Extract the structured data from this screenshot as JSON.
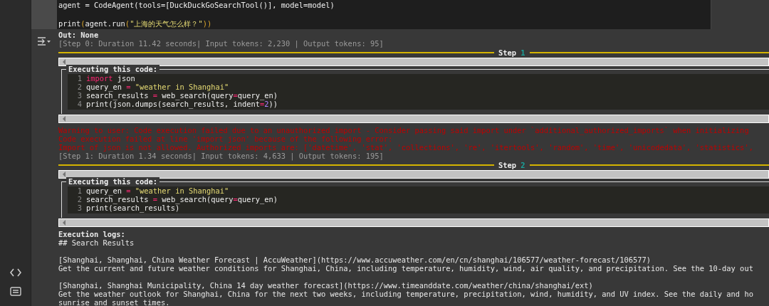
{
  "code_cell": {
    "lines": [
      {
        "kind": "code",
        "tokens": [
          {
            "text": "agent = CodeAgent(tools=[DuckDuckGoSearchTool()], model=model)",
            "kind": "plain"
          }
        ]
      },
      {
        "kind": "blank"
      },
      {
        "kind": "code",
        "tokens": [
          {
            "text": "print",
            "kind": "plain"
          },
          {
            "text": "(",
            "kind": "bracket"
          },
          {
            "text": "agent.run",
            "kind": "plain"
          },
          {
            "text": "(",
            "kind": "bracket"
          },
          {
            "text": "\"上海的天气怎么样？\"",
            "kind": "string"
          },
          {
            "text": "))",
            "kind": "bracket"
          }
        ]
      }
    ]
  },
  "output": {
    "result": "Out: None",
    "blocks": [
      {
        "kind": "summary",
        "text": "[Step 0: Duration 11.42 seconds| Input tokens: 2,230 | Output tokens: 95]"
      },
      {
        "kind": "step_rule",
        "label": "Step",
        "number": "1"
      },
      {
        "kind": "code_box",
        "title": "Executing this code:",
        "lines": [
          {
            "number": "1",
            "tokens": [
              {
                "text": "import",
                "kind": "keyword"
              },
              {
                "text": " json",
                "kind": "plain"
              }
            ]
          },
          {
            "number": "2",
            "tokens": [
              {
                "text": "query_en ",
                "kind": "plain"
              },
              {
                "text": "=",
                "kind": "operator"
              },
              {
                "text": " \"weather in Shanghai\"",
                "kind": "string"
              }
            ]
          },
          {
            "number": "3",
            "tokens": [
              {
                "text": "search_results ",
                "kind": "plain"
              },
              {
                "text": "=",
                "kind": "operator"
              },
              {
                "text": " web_search(query",
                "kind": "plain"
              },
              {
                "text": "=",
                "kind": "operator"
              },
              {
                "text": "query_en)",
                "kind": "plain"
              }
            ]
          },
          {
            "number": "4",
            "tokens": [
              {
                "text": "print(json.dumps(search_results, indent",
                "kind": "plain"
              },
              {
                "text": "=",
                "kind": "operator"
              },
              {
                "text": "2",
                "kind": "number"
              },
              {
                "text": "))",
                "kind": "plain"
              }
            ]
          }
        ]
      },
      {
        "kind": "error",
        "lines": [
          "Warning to user: Code execution failed due to an unauthorized import - Consider passing said import under `additional_authorized_imports` when initializing",
          "Code execution failed at line 'import json' because of the following error:",
          "Import of json is not allowed. Authorized imports are: ['datetime', 'stat', 'collections', 're', 'itertools', 'random', 'time', 'unicodedata', 'statistics',"
        ]
      },
      {
        "kind": "summary",
        "text": "[Step 1: Duration 1.34 seconds| Input tokens: 4,633 | Output tokens: 195]"
      },
      {
        "kind": "step_rule",
        "label": "Step",
        "number": "2"
      },
      {
        "kind": "code_box",
        "title": "Executing this code:",
        "lines": [
          {
            "number": "1",
            "tokens": [
              {
                "text": "query_en ",
                "kind": "plain"
              },
              {
                "text": "=",
                "kind": "operator"
              },
              {
                "text": " \"weather in Shanghai\"",
                "kind": "string"
              }
            ]
          },
          {
            "number": "2",
            "tokens": [
              {
                "text": "search_results ",
                "kind": "plain"
              },
              {
                "text": "=",
                "kind": "operator"
              },
              {
                "text": " web_search(query",
                "kind": "plain"
              },
              {
                "text": "=",
                "kind": "operator"
              },
              {
                "text": "query_en)",
                "kind": "plain"
              }
            ]
          },
          {
            "number": "3",
            "tokens": [
              {
                "text": "print(search_results)",
                "kind": "plain"
              }
            ]
          }
        ]
      },
      {
        "kind": "logs",
        "title": "Execution logs:",
        "paragraphs": [
          [
            "## Search Results"
          ],
          [
            "[Shanghai, Shanghai, China Weather Forecast | AccuWeather](https://www.accuweather.com/en/cn/shanghai/106577/weather-forecast/106577)",
            "Get the current and future weather conditions for Shanghai, China, including temperature, humidity, wind, air quality, and precipitation. See the 10-day out"
          ],
          [
            "[Shanghai, Shanghai Municipality, China 14 day weather forecast](https://www.timeanddate.com/weather/china/shanghai/ext)",
            "Get the weather outlook for Shanghai, China for the next two weeks, including temperature, precipitation, wind, humidity, and UV index. See the daily and ho",
            "sunrise and sunset times."
          ]
        ]
      }
    ]
  }
}
